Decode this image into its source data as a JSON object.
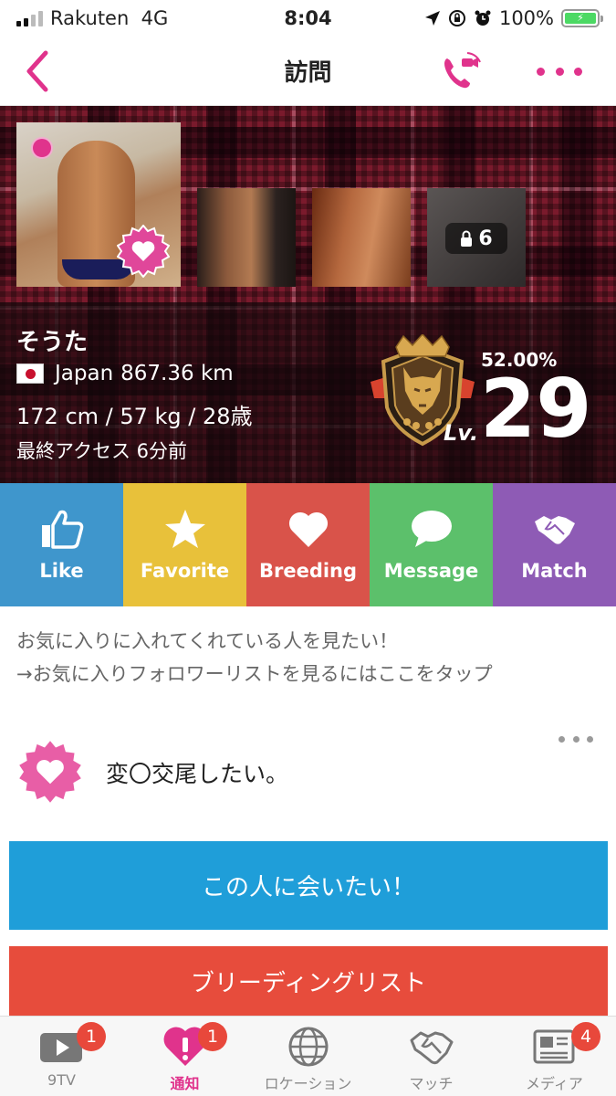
{
  "status_bar": {
    "carrier": "Rakuten",
    "network": "4G",
    "time": "8:04",
    "battery": "100%"
  },
  "nav": {
    "title": "訪問"
  },
  "profile": {
    "name": "そうた",
    "country": "Japan",
    "distance": "867.36 km",
    "stats": "172 cm / 57 kg / 28歳",
    "last_access": "最終アクセス 6分前",
    "locked_photos": "6",
    "level_progress": "52.00%",
    "level_label": "Lv.",
    "level": "29"
  },
  "actions": [
    {
      "label": "Like",
      "color": "#3f96cc",
      "icon": "thumbs-up-icon"
    },
    {
      "label": "Favorite",
      "color": "#e8c13a",
      "icon": "star-icon"
    },
    {
      "label": "Breeding",
      "color": "#d9534a",
      "icon": "heart-icon"
    },
    {
      "label": "Message",
      "color": "#5cc06b",
      "icon": "speech-bubble-icon"
    },
    {
      "label": "Match",
      "color": "#8e5bb5",
      "icon": "handshake-icon"
    }
  ],
  "follow_note": {
    "line1": "お気に入りに入れてくれている人を見たい！",
    "line2": "→お気に入りフォロワーリストを見るにはここをタップ"
  },
  "message": {
    "text": "変〇交尾したい。"
  },
  "buttons": {
    "meet": "この人に会いたい！",
    "breeding_list": "ブリーディングリスト"
  },
  "tabs": [
    {
      "label": "9TV",
      "badge": "1",
      "icon": "play-icon"
    },
    {
      "label": "通知",
      "badge": "1",
      "icon": "heart-alert-icon"
    },
    {
      "label": "ロケーション",
      "badge": "",
      "icon": "globe-icon"
    },
    {
      "label": "マッチ",
      "badge": "",
      "icon": "handshake-icon"
    },
    {
      "label": "メディア",
      "badge": "4",
      "icon": "newspaper-icon"
    }
  ],
  "colors": {
    "accent": "#e0338c",
    "meet_button": "#1f9ed9",
    "breeding_button": "#e74c3c"
  }
}
